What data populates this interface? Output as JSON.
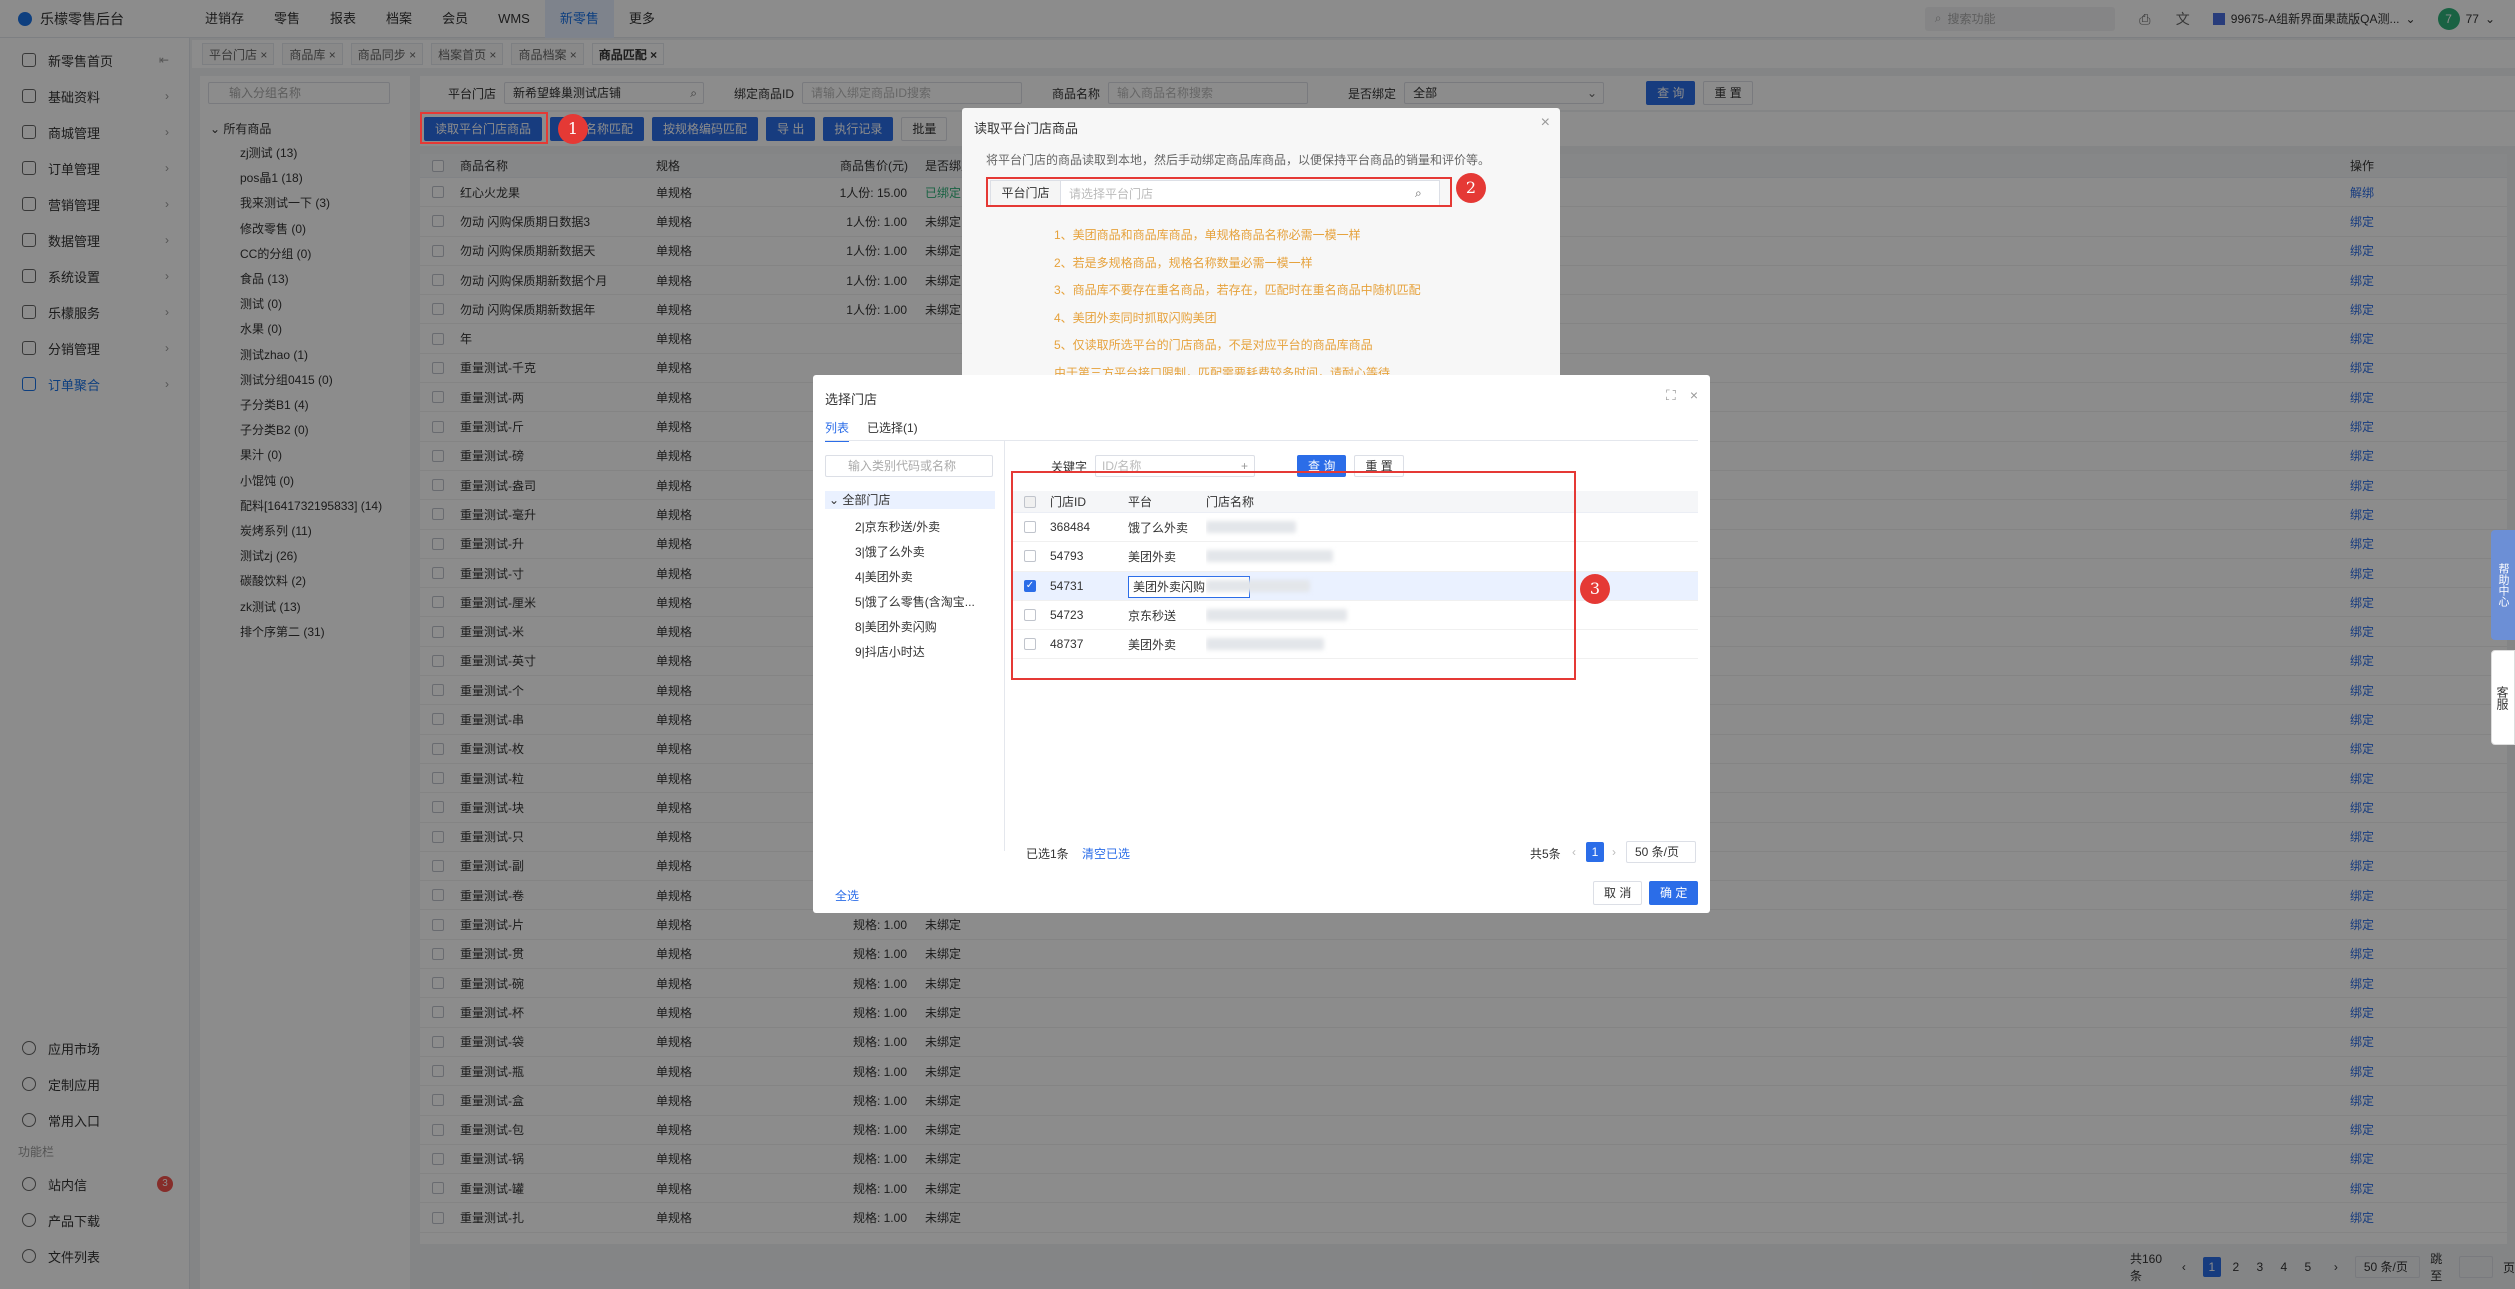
{
  "app": {
    "title": "乐檬零售后台"
  },
  "topnav": [
    "进销存",
    "零售",
    "报表",
    "档案",
    "会员",
    "WMS",
    "新零售",
    "更多"
  ],
  "topnav_active": "新零售",
  "header": {
    "search_placeholder": "搜索功能",
    "tenant": "99675-A组新界面果蔬版QA测...",
    "user_initial": "7",
    "user_count": "77"
  },
  "sidebar": {
    "items": [
      {
        "label": "新零售首页"
      },
      {
        "label": "基础资料"
      },
      {
        "label": "商城管理"
      },
      {
        "label": "订单管理"
      },
      {
        "label": "营销管理"
      },
      {
        "label": "数据管理"
      },
      {
        "label": "系统设置"
      },
      {
        "label": "乐檬服务"
      },
      {
        "label": "分销管理"
      },
      {
        "label": "订单聚合"
      }
    ],
    "bottom": [
      {
        "label": "应用市场"
      },
      {
        "label": "定制应用"
      },
      {
        "label": "常用入口"
      }
    ],
    "section": "功能栏",
    "section_items": [
      {
        "label": "站内信",
        "badge": "3"
      },
      {
        "label": "产品下载"
      },
      {
        "label": "文件列表"
      }
    ]
  },
  "tabs": [
    "平台门店",
    "商品库",
    "商品同步",
    "档案首页",
    "商品档案",
    "商品匹配"
  ],
  "category": {
    "search_placeholder": "输入分组名称",
    "root": "所有商品",
    "items": [
      "zj测试 (13)",
      "pos晶1 (18)",
      "我来测试一下 (3)",
      "修改零售 (0)",
      "CC的分组 (0)",
      "食品 (13)",
      "测试 (0)",
      "水果 (0)",
      "测试zhao (1)",
      "测试分组0415 (0)",
      "子分类B1 (4)",
      "子分类B2 (0)",
      "果汁 (0)",
      "小馄饨 (0)",
      "配料[1641732195833] (14)",
      "炭烤系列 (11)",
      "测试zj (26)",
      "碳酸饮料 (2)",
      "zk测试 (13)",
      "排个序第二 (31)"
    ]
  },
  "filters": {
    "store_label": "平台门店",
    "store_value": "新希望蜂巢测试店铺",
    "bind_id_label": "绑定商品ID",
    "bind_id_placeholder": "请输入绑定商品ID搜索",
    "name_label": "商品名称",
    "name_placeholder": "输入商品名称搜索",
    "bound_label": "是否绑定",
    "bound_value": "全部",
    "query": "查 询",
    "reset": "重 置"
  },
  "actions": [
    "读取平台门店商品",
    "商品名称匹配",
    "按规格编码匹配",
    "导 出",
    "执行记录",
    "批量"
  ],
  "table": {
    "headers": [
      "商品名称",
      "规格",
      "商品售价(元)",
      "是否绑定",
      "操作"
    ],
    "rows": [
      {
        "name": "红心火龙果",
        "spec": "单规格",
        "price": "1人份: 15.00",
        "bound": "已绑定",
        "op": "解绑"
      },
      {
        "name": "勿动 闪购保质期日数据3",
        "spec": "单规格",
        "price": "1人份: 1.00",
        "bound": "未绑定",
        "op": "绑定"
      },
      {
        "name": "勿动 闪购保质期新数据天",
        "spec": "单规格",
        "price": "1人份: 1.00",
        "bound": "未绑定",
        "op": "绑定"
      },
      {
        "name": "勿动 闪购保质期新数据个月",
        "spec": "单规格",
        "price": "1人份: 1.00",
        "bound": "未绑定",
        "op": "绑定"
      },
      {
        "name": "勿动 闪购保质期新数据年",
        "spec": "单规格",
        "price": "1人份: 1.00",
        "bound": "未绑定",
        "op": "绑定"
      },
      {
        "name": "年",
        "spec": "单规格",
        "price": "",
        "bound": "",
        "op": "绑定"
      },
      {
        "name": "重量测试-千克",
        "spec": "单规格",
        "price": "",
        "bound": "",
        "op": "绑定"
      },
      {
        "name": "重量测试-两",
        "spec": "单规格",
        "price": "",
        "bound": "",
        "op": "绑定"
      },
      {
        "name": "重量测试-斤",
        "spec": "单规格",
        "price": "",
        "bound": "",
        "op": "绑定"
      },
      {
        "name": "重量测试-磅",
        "spec": "单规格",
        "price": "",
        "bound": "",
        "op": "绑定"
      },
      {
        "name": "重量测试-盎司",
        "spec": "单规格",
        "price": "",
        "bound": "",
        "op": "绑定"
      },
      {
        "name": "重量测试-毫升",
        "spec": "单规格",
        "price": "",
        "bound": "",
        "op": "绑定"
      },
      {
        "name": "重量测试-升",
        "spec": "单规格",
        "price": "",
        "bound": "",
        "op": "绑定"
      },
      {
        "name": "重量测试-寸",
        "spec": "单规格",
        "price": "",
        "bound": "",
        "op": "绑定"
      },
      {
        "name": "重量测试-厘米",
        "spec": "单规格",
        "price": "",
        "bound": "",
        "op": "绑定"
      },
      {
        "name": "重量测试-米",
        "spec": "单规格",
        "price": "",
        "bound": "",
        "op": "绑定"
      },
      {
        "name": "重量测试-英寸",
        "spec": "单规格",
        "price": "",
        "bound": "",
        "op": "绑定"
      },
      {
        "name": "重量测试-个",
        "spec": "单规格",
        "price": "",
        "bound": "",
        "op": "绑定"
      },
      {
        "name": "重量测试-串",
        "spec": "单规格",
        "price": "",
        "bound": "",
        "op": "绑定"
      },
      {
        "name": "重量测试-枚",
        "spec": "单规格",
        "price": "",
        "bound": "",
        "op": "绑定"
      },
      {
        "name": "重量测试-粒",
        "spec": "单规格",
        "price": "",
        "bound": "",
        "op": "绑定"
      },
      {
        "name": "重量测试-块",
        "spec": "单规格",
        "price": "",
        "bound": "",
        "op": "绑定"
      },
      {
        "name": "重量测试-只",
        "spec": "单规格",
        "price": "",
        "bound": "",
        "op": "绑定"
      },
      {
        "name": "重量测试-副",
        "spec": "单规格",
        "price": "",
        "bound": "",
        "op": "绑定"
      },
      {
        "name": "重量测试-卷",
        "spec": "单规格",
        "price": "",
        "bound": "",
        "op": "绑定"
      },
      {
        "name": "重量测试-片",
        "spec": "单规格",
        "price": "规格: 1.00",
        "bound": "未绑定",
        "op": "绑定"
      },
      {
        "name": "重量测试-贯",
        "spec": "单规格",
        "price": "规格: 1.00",
        "bound": "未绑定",
        "op": "绑定"
      },
      {
        "name": "重量测试-碗",
        "spec": "单规格",
        "price": "规格: 1.00",
        "bound": "未绑定",
        "op": "绑定"
      },
      {
        "name": "重量测试-杯",
        "spec": "单规格",
        "price": "规格: 1.00",
        "bound": "未绑定",
        "op": "绑定"
      },
      {
        "name": "重量测试-袋",
        "spec": "单规格",
        "price": "规格: 1.00",
        "bound": "未绑定",
        "op": "绑定"
      },
      {
        "name": "重量测试-瓶",
        "spec": "单规格",
        "price": "规格: 1.00",
        "bound": "未绑定",
        "op": "绑定"
      },
      {
        "name": "重量测试-盒",
        "spec": "单规格",
        "price": "规格: 1.00",
        "bound": "未绑定",
        "op": "绑定"
      },
      {
        "name": "重量测试-包",
        "spec": "单规格",
        "price": "规格: 1.00",
        "bound": "未绑定",
        "op": "绑定"
      },
      {
        "name": "重量测试-锅",
        "spec": "单规格",
        "price": "规格: 1.00",
        "bound": "未绑定",
        "op": "绑定"
      },
      {
        "name": "重量测试-罐",
        "spec": "单规格",
        "price": "规格: 1.00",
        "bound": "未绑定",
        "op": "绑定"
      },
      {
        "name": "重量测试-扎",
        "spec": "单规格",
        "price": "规格: 1.00",
        "bound": "未绑定",
        "op": "绑定"
      }
    ]
  },
  "pager": {
    "total": "共160条",
    "pages": [
      "1",
      "2",
      "3",
      "4",
      "5"
    ],
    "size": "50 条/页",
    "jump": "跳至",
    "page_suffix": "页"
  },
  "dialog_read": {
    "title": "读取平台门店商品",
    "desc": "将平台门店的商品读取到本地，然后手动绑定商品库商品，以便保持平台商品的销量和评价等。",
    "store_label": "平台门店",
    "store_placeholder": "请选择平台门店",
    "tips": [
      "1、美团商品和商品库商品，单规格商品名称必需一模一样",
      "2、若是多规格商品，规格名称数量必需一模一样",
      "3、商品库不要存在重名商品，若存在，匹配时在重名商品中随机匹配",
      "4、美团外卖同时抓取闪购美团",
      "5、仅读取所选平台的门店商品，不是对应平台的商品库商品",
      "由于第三方平台接口限制，匹配需要耗费较多时间，请耐心等待"
    ]
  },
  "dialog_select": {
    "title": "选择门店",
    "tabs": [
      "列表",
      "已选择(1)"
    ],
    "search_placeholder": "输入类别代码或名称",
    "tree_root": "全部门店",
    "tree": [
      "2|京东秒送/外卖",
      "3|饿了么外卖",
      "4|美团外卖",
      "5|饿了么零售(含淘宝...",
      "8|美团外卖闪购",
      "9|抖店小时达"
    ],
    "keyword_label": "关键字",
    "keyword_placeholder": "ID/名称",
    "query": "查 询",
    "reset": "重 置",
    "headers": [
      "门店ID",
      "平台",
      "门店名称"
    ],
    "rows": [
      {
        "id": "368484",
        "platform": "饿了么外卖",
        "checked": false
      },
      {
        "id": "54793",
        "platform": "美团外卖",
        "checked": false
      },
      {
        "id": "54731",
        "platform": "美团外卖闪购",
        "checked": true
      },
      {
        "id": "54723",
        "platform": "京东秒送",
        "checked": false
      },
      {
        "id": "48737",
        "platform": "美团外卖",
        "checked": false
      }
    ],
    "selected_count": "已选1条",
    "clear": "清空已选",
    "total": "共5条",
    "page": "1",
    "page_size": "50 条/页",
    "select_all": "全选",
    "cancel": "取 消",
    "ok": "确 定"
  },
  "markers": [
    "1",
    "2",
    "3"
  ],
  "float": {
    "help": "帮助中心",
    "service": "客服"
  },
  "colors": {
    "primary": "#2b6de8",
    "warning": "#e6a23c",
    "marker": "#e53935"
  }
}
